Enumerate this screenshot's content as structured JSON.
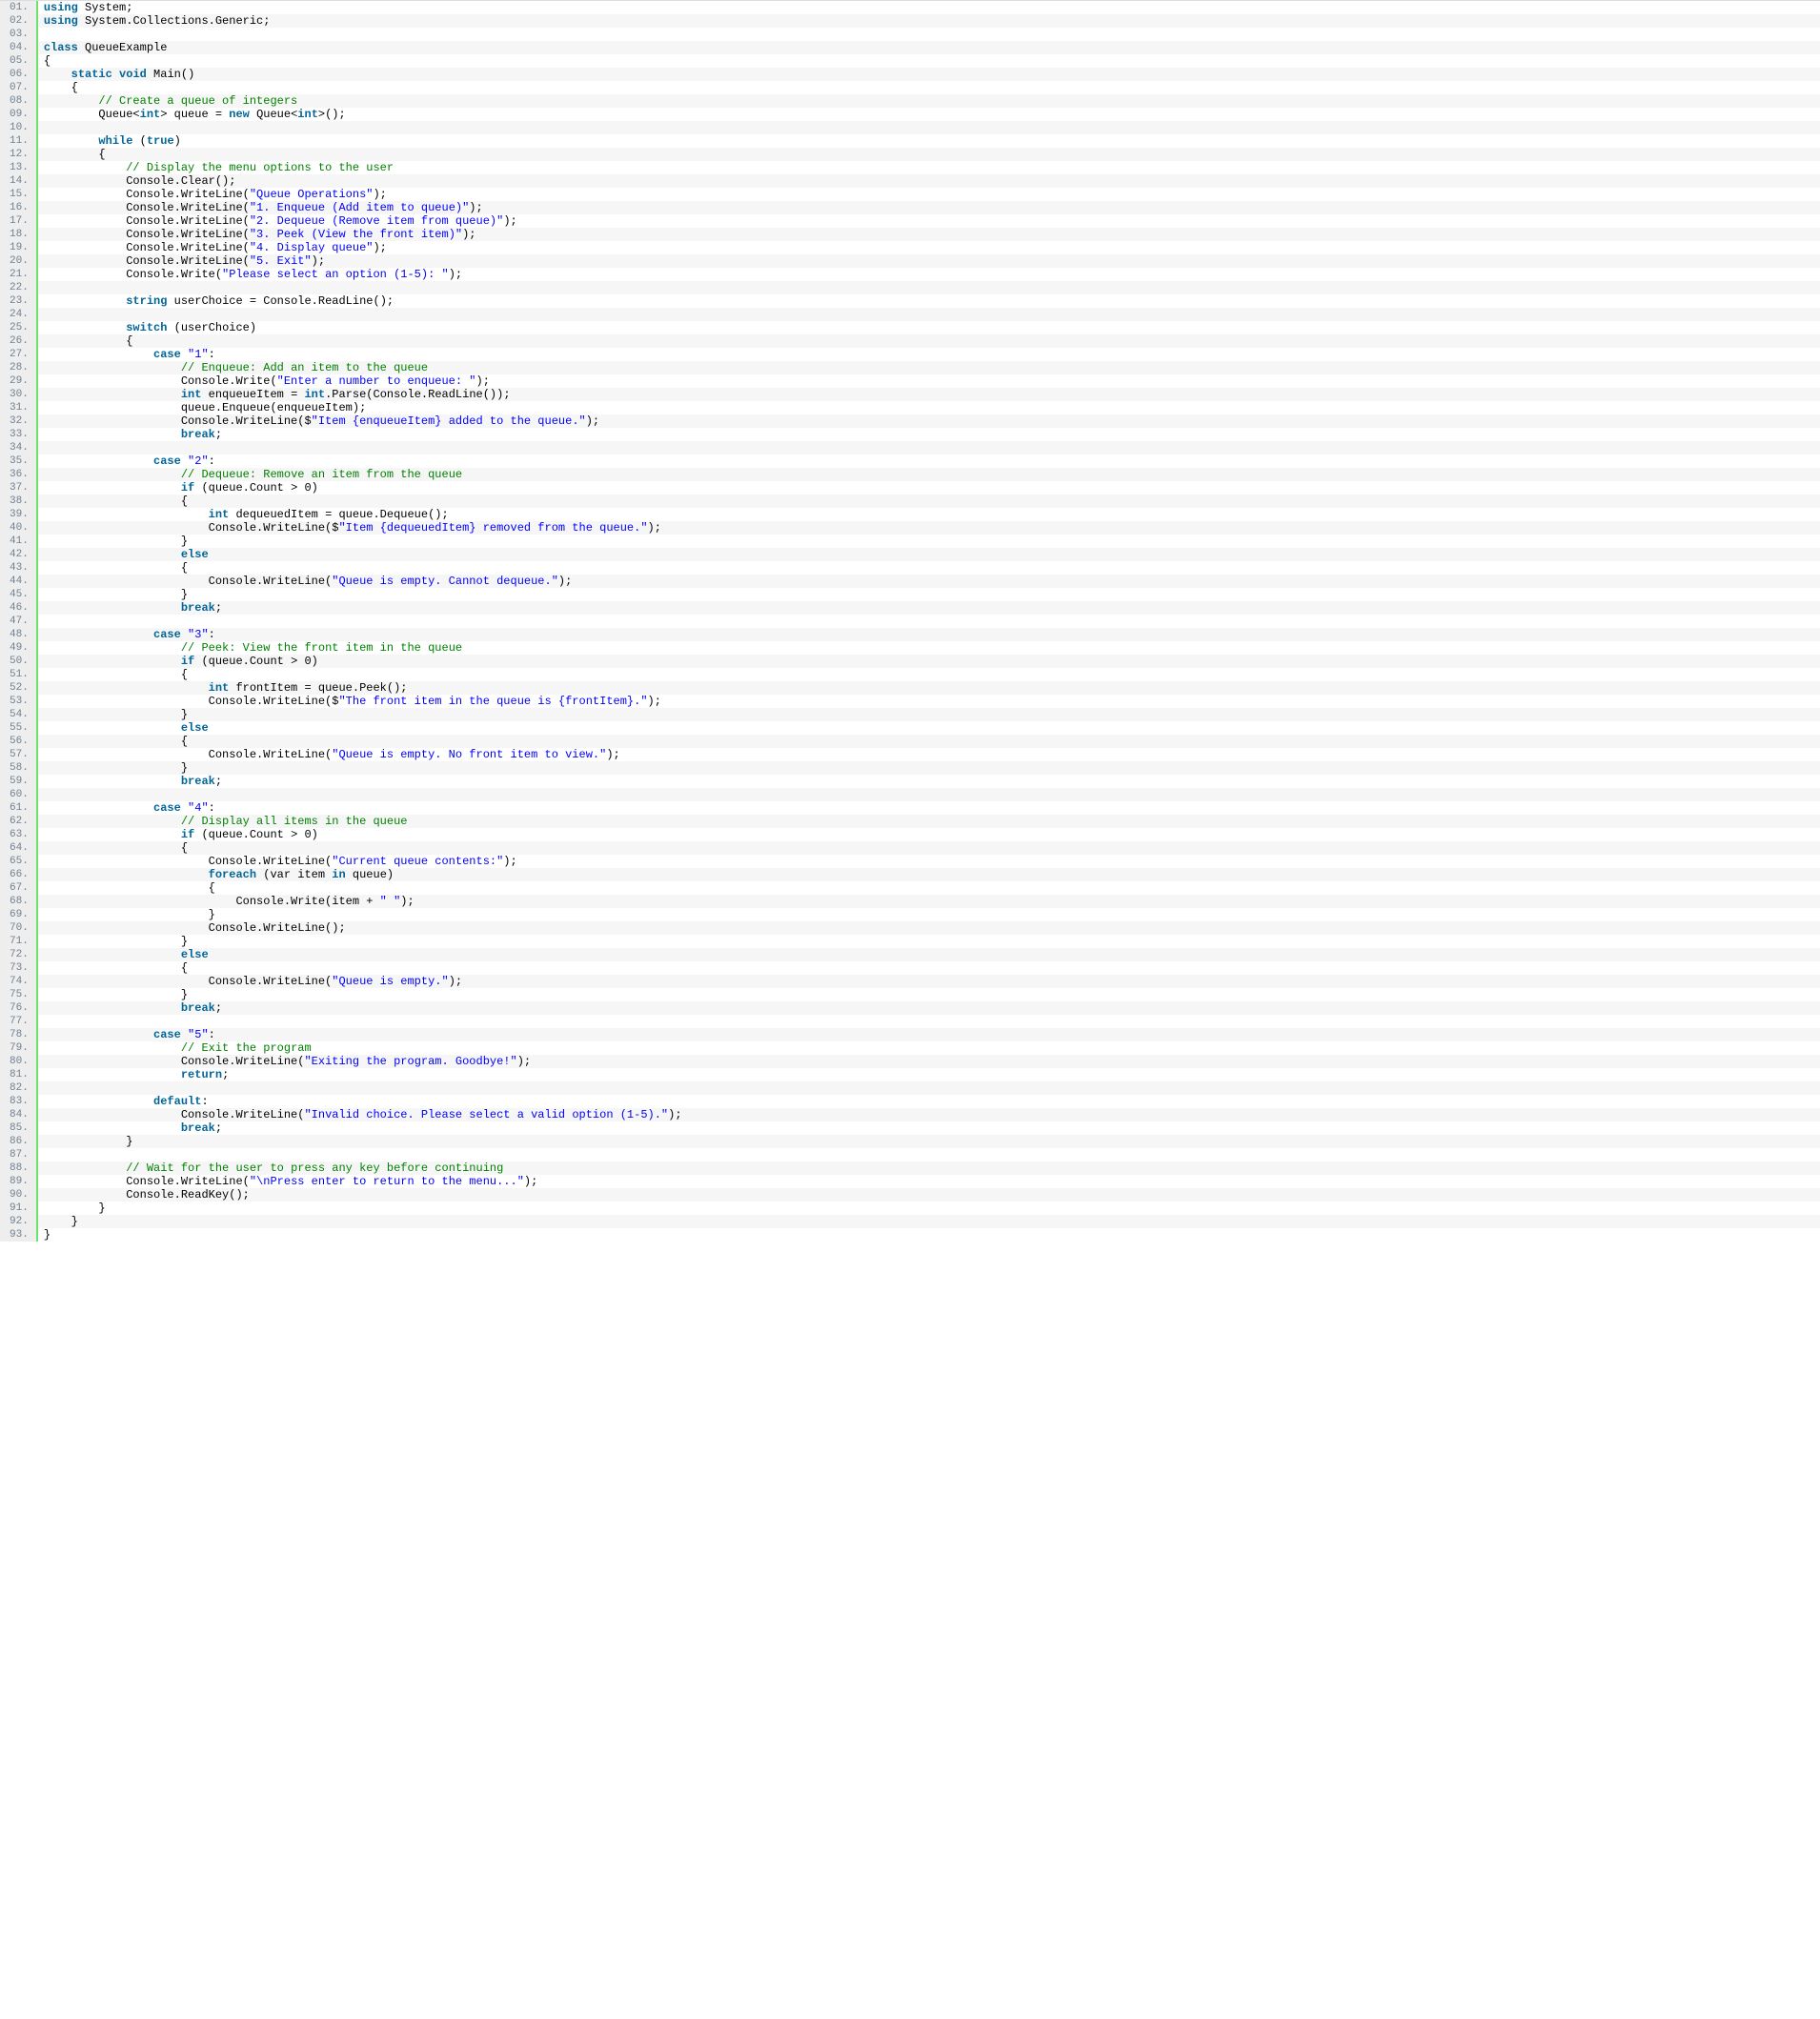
{
  "lines": [
    [
      [
        "kw",
        "using"
      ],
      [
        "plain",
        " System;"
      ]
    ],
    [
      [
        "kw",
        "using"
      ],
      [
        "plain",
        " System.Collections.Generic;"
      ]
    ],
    [
      [
        "plain",
        " "
      ]
    ],
    [
      [
        "kw",
        "class"
      ],
      [
        "plain",
        " QueueExample"
      ]
    ],
    [
      [
        "plain",
        "{"
      ]
    ],
    [
      [
        "plain",
        "    "
      ],
      [
        "kw",
        "static"
      ],
      [
        "plain",
        " "
      ],
      [
        "kw",
        "void"
      ],
      [
        "plain",
        " Main()"
      ]
    ],
    [
      [
        "plain",
        "    {"
      ]
    ],
    [
      [
        "plain",
        "        "
      ],
      [
        "cm",
        "// Create a queue of integers"
      ]
    ],
    [
      [
        "plain",
        "        Queue<"
      ],
      [
        "kw",
        "int"
      ],
      [
        "plain",
        "> queue = "
      ],
      [
        "kw",
        "new"
      ],
      [
        "plain",
        " Queue<"
      ],
      [
        "kw",
        "int"
      ],
      [
        "plain",
        ">();"
      ]
    ],
    [
      [
        "plain",
        " "
      ]
    ],
    [
      [
        "plain",
        "        "
      ],
      [
        "kw",
        "while"
      ],
      [
        "plain",
        " ("
      ],
      [
        "kw",
        "true"
      ],
      [
        "plain",
        ")"
      ]
    ],
    [
      [
        "plain",
        "        {"
      ]
    ],
    [
      [
        "plain",
        "            "
      ],
      [
        "cm",
        "// Display the menu options to the user"
      ]
    ],
    [
      [
        "plain",
        "            Console.Clear();"
      ]
    ],
    [
      [
        "plain",
        "            Console.WriteLine("
      ],
      [
        "str",
        "\"Queue Operations\""
      ],
      [
        "plain",
        ");"
      ]
    ],
    [
      [
        "plain",
        "            Console.WriteLine("
      ],
      [
        "str",
        "\"1. Enqueue (Add item to queue)\""
      ],
      [
        "plain",
        ");"
      ]
    ],
    [
      [
        "plain",
        "            Console.WriteLine("
      ],
      [
        "str",
        "\"2. Dequeue (Remove item from queue)\""
      ],
      [
        "plain",
        ");"
      ]
    ],
    [
      [
        "plain",
        "            Console.WriteLine("
      ],
      [
        "str",
        "\"3. Peek (View the front item)\""
      ],
      [
        "plain",
        ");"
      ]
    ],
    [
      [
        "plain",
        "            Console.WriteLine("
      ],
      [
        "str",
        "\"4. Display queue\""
      ],
      [
        "plain",
        ");"
      ]
    ],
    [
      [
        "plain",
        "            Console.WriteLine("
      ],
      [
        "str",
        "\"5. Exit\""
      ],
      [
        "plain",
        ");"
      ]
    ],
    [
      [
        "plain",
        "            Console.Write("
      ],
      [
        "str",
        "\"Please select an option (1-5): \""
      ],
      [
        "plain",
        ");"
      ]
    ],
    [
      [
        "plain",
        " "
      ]
    ],
    [
      [
        "plain",
        "            "
      ],
      [
        "kw",
        "string"
      ],
      [
        "plain",
        " userChoice = Console.ReadLine();"
      ]
    ],
    [
      [
        "plain",
        " "
      ]
    ],
    [
      [
        "plain",
        "            "
      ],
      [
        "kw",
        "switch"
      ],
      [
        "plain",
        " (userChoice)"
      ]
    ],
    [
      [
        "plain",
        "            {"
      ]
    ],
    [
      [
        "plain",
        "                "
      ],
      [
        "kw",
        "case"
      ],
      [
        "plain",
        " "
      ],
      [
        "str",
        "\"1\""
      ],
      [
        "plain",
        ":"
      ]
    ],
    [
      [
        "plain",
        "                    "
      ],
      [
        "cm",
        "// Enqueue: Add an item to the queue"
      ]
    ],
    [
      [
        "plain",
        "                    Console.Write("
      ],
      [
        "str",
        "\"Enter a number to enqueue: \""
      ],
      [
        "plain",
        ");"
      ]
    ],
    [
      [
        "plain",
        "                    "
      ],
      [
        "kw",
        "int"
      ],
      [
        "plain",
        " enqueueItem = "
      ],
      [
        "kw",
        "int"
      ],
      [
        "plain",
        ".Parse(Console.ReadLine());"
      ]
    ],
    [
      [
        "plain",
        "                    queue.Enqueue(enqueueItem);"
      ]
    ],
    [
      [
        "plain",
        "                    Console.WriteLine($"
      ],
      [
        "str",
        "\"Item {enqueueItem} added to the queue.\""
      ],
      [
        "plain",
        ");"
      ]
    ],
    [
      [
        "plain",
        "                    "
      ],
      [
        "kw",
        "break"
      ],
      [
        "plain",
        ";"
      ]
    ],
    [
      [
        "plain",
        " "
      ]
    ],
    [
      [
        "plain",
        "                "
      ],
      [
        "kw",
        "case"
      ],
      [
        "plain",
        " "
      ],
      [
        "str",
        "\"2\""
      ],
      [
        "plain",
        ":"
      ]
    ],
    [
      [
        "plain",
        "                    "
      ],
      [
        "cm",
        "// Dequeue: Remove an item from the queue"
      ]
    ],
    [
      [
        "plain",
        "                    "
      ],
      [
        "kw",
        "if"
      ],
      [
        "plain",
        " (queue.Count > 0)"
      ]
    ],
    [
      [
        "plain",
        "                    {"
      ]
    ],
    [
      [
        "plain",
        "                        "
      ],
      [
        "kw",
        "int"
      ],
      [
        "plain",
        " dequeuedItem = queue.Dequeue();"
      ]
    ],
    [
      [
        "plain",
        "                        Console.WriteLine($"
      ],
      [
        "str",
        "\"Item {dequeuedItem} removed from the queue.\""
      ],
      [
        "plain",
        ");"
      ]
    ],
    [
      [
        "plain",
        "                    }"
      ]
    ],
    [
      [
        "plain",
        "                    "
      ],
      [
        "kw",
        "else"
      ]
    ],
    [
      [
        "plain",
        "                    {"
      ]
    ],
    [
      [
        "plain",
        "                        Console.WriteLine("
      ],
      [
        "str",
        "\"Queue is empty. Cannot dequeue.\""
      ],
      [
        "plain",
        ");"
      ]
    ],
    [
      [
        "plain",
        "                    }"
      ]
    ],
    [
      [
        "plain",
        "                    "
      ],
      [
        "kw",
        "break"
      ],
      [
        "plain",
        ";"
      ]
    ],
    [
      [
        "plain",
        " "
      ]
    ],
    [
      [
        "plain",
        "                "
      ],
      [
        "kw",
        "case"
      ],
      [
        "plain",
        " "
      ],
      [
        "str",
        "\"3\""
      ],
      [
        "plain",
        ":"
      ]
    ],
    [
      [
        "plain",
        "                    "
      ],
      [
        "cm",
        "// Peek: View the front item in the queue"
      ]
    ],
    [
      [
        "plain",
        "                    "
      ],
      [
        "kw",
        "if"
      ],
      [
        "plain",
        " (queue.Count > 0)"
      ]
    ],
    [
      [
        "plain",
        "                    {"
      ]
    ],
    [
      [
        "plain",
        "                        "
      ],
      [
        "kw",
        "int"
      ],
      [
        "plain",
        " frontItem = queue.Peek();"
      ]
    ],
    [
      [
        "plain",
        "                        Console.WriteLine($"
      ],
      [
        "str",
        "\"The front item in the queue is {frontItem}.\""
      ],
      [
        "plain",
        ");"
      ]
    ],
    [
      [
        "plain",
        "                    }"
      ]
    ],
    [
      [
        "plain",
        "                    "
      ],
      [
        "kw",
        "else"
      ]
    ],
    [
      [
        "plain",
        "                    {"
      ]
    ],
    [
      [
        "plain",
        "                        Console.WriteLine("
      ],
      [
        "str",
        "\"Queue is empty. No front item to view.\""
      ],
      [
        "plain",
        ");"
      ]
    ],
    [
      [
        "plain",
        "                    }"
      ]
    ],
    [
      [
        "plain",
        "                    "
      ],
      [
        "kw",
        "break"
      ],
      [
        "plain",
        ";"
      ]
    ],
    [
      [
        "plain",
        " "
      ]
    ],
    [
      [
        "plain",
        "                "
      ],
      [
        "kw",
        "case"
      ],
      [
        "plain",
        " "
      ],
      [
        "str",
        "\"4\""
      ],
      [
        "plain",
        ":"
      ]
    ],
    [
      [
        "plain",
        "                    "
      ],
      [
        "cm",
        "// Display all items in the queue"
      ]
    ],
    [
      [
        "plain",
        "                    "
      ],
      [
        "kw",
        "if"
      ],
      [
        "plain",
        " (queue.Count > 0)"
      ]
    ],
    [
      [
        "plain",
        "                    {"
      ]
    ],
    [
      [
        "plain",
        "                        Console.WriteLine("
      ],
      [
        "str",
        "\"Current queue contents:\""
      ],
      [
        "plain",
        ");"
      ]
    ],
    [
      [
        "plain",
        "                        "
      ],
      [
        "kw",
        "foreach"
      ],
      [
        "plain",
        " (var item "
      ],
      [
        "kw",
        "in"
      ],
      [
        "plain",
        " queue)"
      ]
    ],
    [
      [
        "plain",
        "                        {"
      ]
    ],
    [
      [
        "plain",
        "                            Console.Write(item + "
      ],
      [
        "str",
        "\" \""
      ],
      [
        "plain",
        ");"
      ]
    ],
    [
      [
        "plain",
        "                        }"
      ]
    ],
    [
      [
        "plain",
        "                        Console.WriteLine();"
      ]
    ],
    [
      [
        "plain",
        "                    }"
      ]
    ],
    [
      [
        "plain",
        "                    "
      ],
      [
        "kw",
        "else"
      ]
    ],
    [
      [
        "plain",
        "                    {"
      ]
    ],
    [
      [
        "plain",
        "                        Console.WriteLine("
      ],
      [
        "str",
        "\"Queue is empty.\""
      ],
      [
        "plain",
        ");"
      ]
    ],
    [
      [
        "plain",
        "                    }"
      ]
    ],
    [
      [
        "plain",
        "                    "
      ],
      [
        "kw",
        "break"
      ],
      [
        "plain",
        ";"
      ]
    ],
    [
      [
        "plain",
        " "
      ]
    ],
    [
      [
        "plain",
        "                "
      ],
      [
        "kw",
        "case"
      ],
      [
        "plain",
        " "
      ],
      [
        "str",
        "\"5\""
      ],
      [
        "plain",
        ":"
      ]
    ],
    [
      [
        "plain",
        "                    "
      ],
      [
        "cm",
        "// Exit the program"
      ]
    ],
    [
      [
        "plain",
        "                    Console.WriteLine("
      ],
      [
        "str",
        "\"Exiting the program. Goodbye!\""
      ],
      [
        "plain",
        ");"
      ]
    ],
    [
      [
        "plain",
        "                    "
      ],
      [
        "kw",
        "return"
      ],
      [
        "plain",
        ";"
      ]
    ],
    [
      [
        "plain",
        " "
      ]
    ],
    [
      [
        "plain",
        "                "
      ],
      [
        "kw",
        "default"
      ],
      [
        "plain",
        ":"
      ]
    ],
    [
      [
        "plain",
        "                    Console.WriteLine("
      ],
      [
        "str",
        "\"Invalid choice. Please select a valid option (1-5).\""
      ],
      [
        "plain",
        ");"
      ]
    ],
    [
      [
        "plain",
        "                    "
      ],
      [
        "kw",
        "break"
      ],
      [
        "plain",
        ";"
      ]
    ],
    [
      [
        "plain",
        "            }"
      ]
    ],
    [
      [
        "plain",
        " "
      ]
    ],
    [
      [
        "plain",
        "            "
      ],
      [
        "cm",
        "// Wait for the user to press any key before continuing"
      ]
    ],
    [
      [
        "plain",
        "            Console.WriteLine("
      ],
      [
        "str",
        "\"\\nPress enter to return to the menu...\""
      ],
      [
        "plain",
        ");"
      ]
    ],
    [
      [
        "plain",
        "            Console.ReadKey();"
      ]
    ],
    [
      [
        "plain",
        "        }"
      ]
    ],
    [
      [
        "plain",
        "    }"
      ]
    ],
    [
      [
        "plain",
        "}"
      ]
    ]
  ]
}
